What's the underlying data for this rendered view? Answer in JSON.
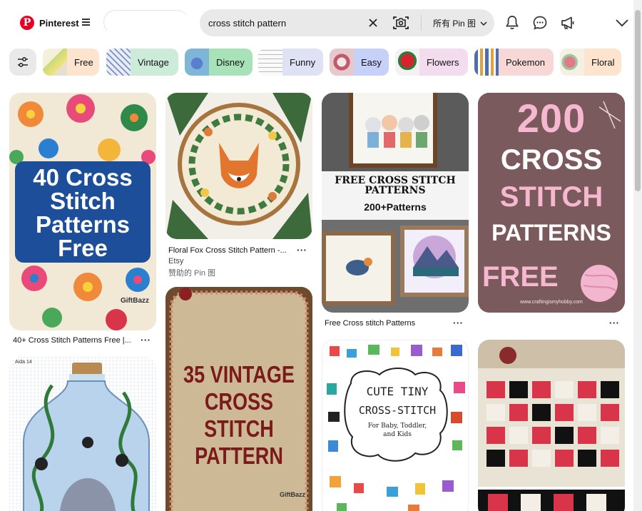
{
  "header": {
    "logo_text": "Pinterest",
    "search_value": "cross stitch pattern",
    "scope_label": "所有 Pin 图"
  },
  "icons": {
    "menu": "menu-icon",
    "clear": "close-icon",
    "camera": "camera-search-icon",
    "notifications": "bell-icon",
    "messages": "chat-icon",
    "updates": "megaphone-icon",
    "account": "chevron-down-icon",
    "filters": "sliders-icon"
  },
  "chips": [
    {
      "label": "Free"
    },
    {
      "label": "Vintage"
    },
    {
      "label": "Disney"
    },
    {
      "label": "Funny"
    },
    {
      "label": "Easy"
    },
    {
      "label": "Flowers"
    },
    {
      "label": "Pokemon"
    },
    {
      "label": "Floral"
    }
  ],
  "pins": {
    "p1": {
      "title": "40+ Cross Stitch Patterns Free |...",
      "image_text": [
        "40 Cross",
        "Stitch",
        "Patterns",
        "Free"
      ],
      "watermark": "GiftBazz"
    },
    "p2": {
      "title": "Floral Fox Cross Stitch Pattern -...",
      "source": "Etsy",
      "sponsored": "赞助的 Pin 图"
    },
    "p3": {
      "title": "Free Cross stitch Patterns",
      "image_text": [
        "FREE CROSS STITCH",
        "PATTERNS",
        "200+Patterns"
      ]
    },
    "p4": {
      "image_text": [
        "200",
        "CROSS",
        "STITCH",
        "PATTERNS",
        "FREE"
      ],
      "url_text": "www.craftingismyhobby.com"
    },
    "p5": {
      "image_text": "Aida 14"
    },
    "p6": {
      "image_text": [
        "35 VINTAGE",
        "CROSS STITCH",
        "PATTERN"
      ],
      "watermark": "GiftBazz"
    },
    "p7": {
      "image_text": [
        "CUTE TINY",
        "CROSS-STITCH",
        "For Baby, Toddler,",
        "and Kids"
      ]
    },
    "p8": {}
  },
  "more_label": "···",
  "colors": {
    "brand": "#e60023",
    "search_bg": "#e9e9e9"
  }
}
